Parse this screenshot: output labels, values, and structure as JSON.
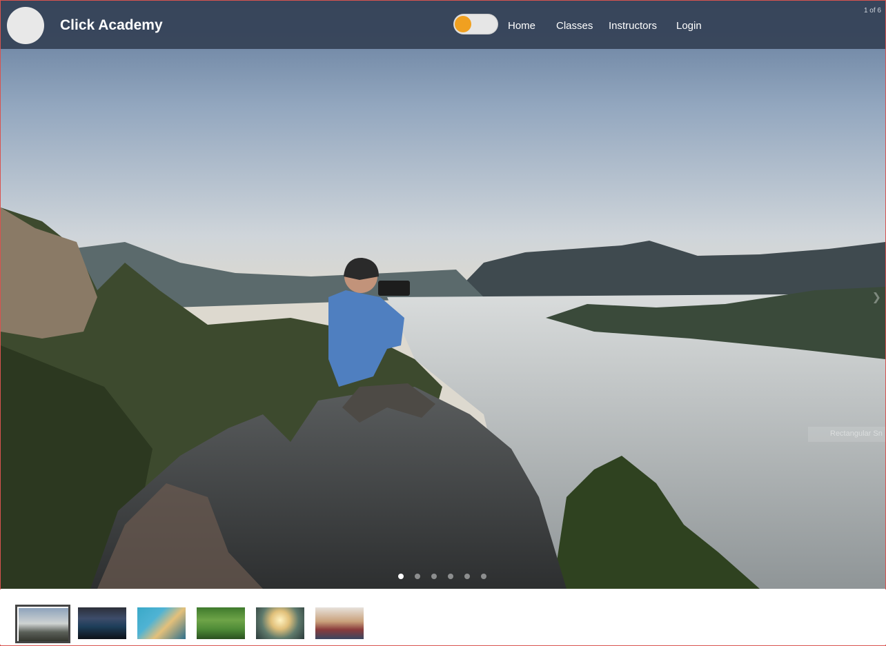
{
  "header": {
    "brand": "Click Academy",
    "nav": [
      "Home",
      "Classes",
      "Instructors",
      "Login"
    ],
    "counter": "1 of 6"
  },
  "slider": {
    "total_slides": 6,
    "active_index": 0,
    "watermark": "Rectangular Sn",
    "next_icon": "chevron-right-icon"
  },
  "thumbnails": [
    {
      "subject": "mountain-photographer"
    },
    {
      "subject": "computer-lab"
    },
    {
      "subject": "classroom"
    },
    {
      "subject": "outdoor-photographer"
    },
    {
      "subject": "camera-portrait"
    },
    {
      "subject": "group-photo"
    }
  ],
  "colors": {
    "header_bg": "#344156",
    "toggle_knob": "#f0a020",
    "frame_border": "#d9534f"
  }
}
